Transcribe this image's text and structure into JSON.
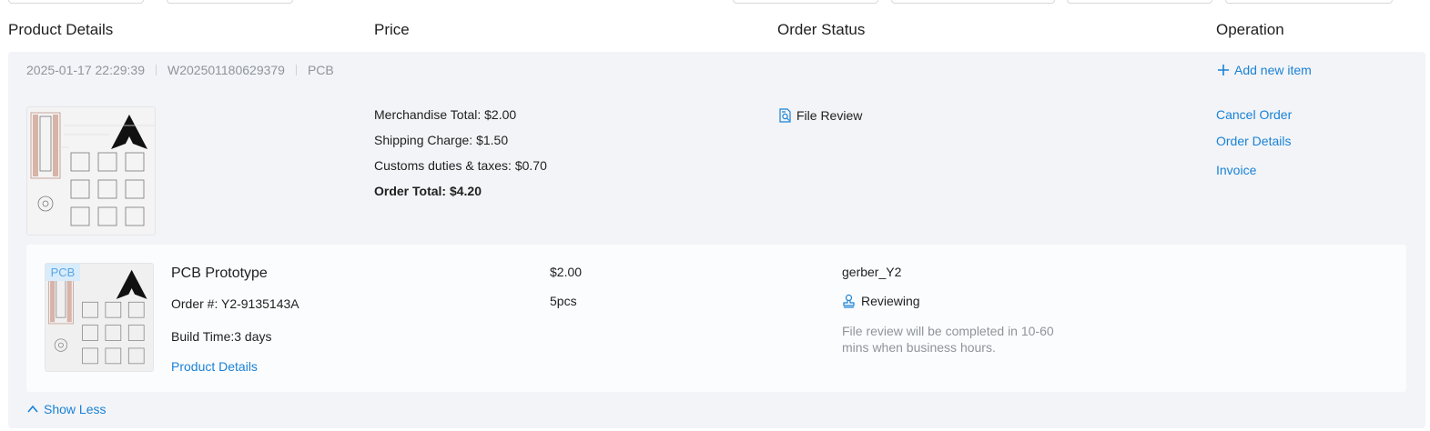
{
  "headers": {
    "product_details": "Product Details",
    "price": "Price",
    "order_status": "Order Status",
    "operation": "Operation"
  },
  "order": {
    "datetime": "2025-01-17 22:29:39",
    "order_id": "W202501180629379",
    "type": "PCB",
    "add_new_item": "Add new item",
    "price_lines": {
      "merchandise_total": "Merchandise Total: $2.00",
      "shipping_charge": "Shipping Charge: $1.50",
      "customs": "Customs duties & taxes: $0.70",
      "order_total": "Order Total: $4.20"
    },
    "status": {
      "icon": "file-search-icon",
      "label": "File Review"
    },
    "operations": {
      "cancel": "Cancel Order",
      "details": "Order Details",
      "invoice": "Invoice"
    },
    "item": {
      "tag": "PCB",
      "name": "PCB Prototype",
      "order_no": "Order #: Y2-9135143A",
      "build_time": "Build Time:3 days",
      "product_details_link": "Product Details",
      "price": "$2.00",
      "quantity": "5pcs",
      "file_name": "gerber_Y2",
      "review_icon": "stamp-icon",
      "review_status": "Reviewing",
      "review_note_line1": "File review will be completed in 10-60",
      "review_note_line2": "mins when business hours."
    },
    "show_less": "Show Less"
  },
  "colors": {
    "accent": "#1a82d6",
    "order_bg": "#f2f4f7",
    "muted": "#8f949a"
  }
}
